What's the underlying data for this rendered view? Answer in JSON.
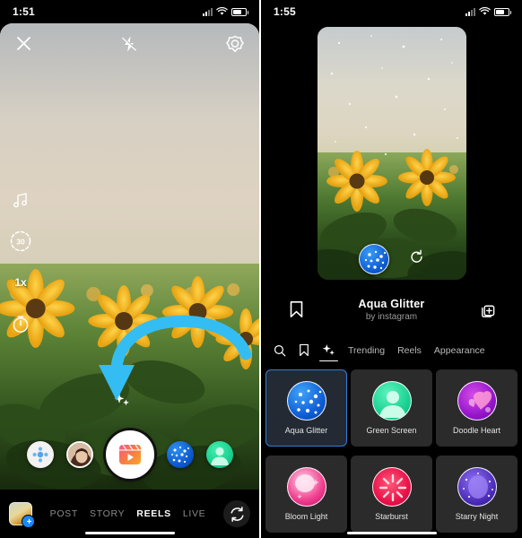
{
  "left_phone": {
    "status": {
      "time": "1:51",
      "signal_icon": "cellular-signal-icon",
      "wifi_icon": "wifi-icon",
      "battery_icon": "battery-icon"
    },
    "camera_top": {
      "close_label": "close-icon",
      "flash_label": "flash-off-icon",
      "settings_label": "settings-gear-icon"
    },
    "rail": [
      {
        "name": "music-icon",
        "label": ""
      },
      {
        "name": "duration-30s-icon",
        "label": "30"
      },
      {
        "name": "speed-icon",
        "label": "1x"
      },
      {
        "name": "timer-icon",
        "label": ""
      }
    ],
    "annotation": {
      "arrow": "curved-down-arrow",
      "color": "#33bdf2"
    },
    "effects_row": [
      {
        "name": "dial-effect",
        "label": "effects-dial"
      },
      {
        "name": "avatar-effect",
        "label": "user-avatar-effect"
      },
      {
        "name": "shutter",
        "label": "record-button"
      },
      {
        "name": "aqua-glitter-effect",
        "label": "Aqua Glitter"
      },
      {
        "name": "green-screen-effect",
        "label": "Green Screen"
      }
    ],
    "modes": [
      {
        "label": "POST",
        "active": false
      },
      {
        "label": "STORY",
        "active": false
      },
      {
        "label": "REELS",
        "active": true
      },
      {
        "label": "LIVE",
        "active": false
      }
    ],
    "gallery_thumb": {
      "name": "gallery-thumbnail",
      "badge": "+"
    },
    "flip_camera": "flip-camera-icon"
  },
  "right_phone": {
    "status": {
      "time": "1:55",
      "signal_icon": "cellular-signal-icon",
      "wifi_icon": "wifi-icon",
      "battery_icon": "battery-icon"
    },
    "preview": {
      "effect_button": "aqua-glitter-effect-button",
      "refresh_button": "reload-effect-icon"
    },
    "effect_meta": {
      "save_icon": "bookmark-icon",
      "title": "Aqua Glitter",
      "author": "by instagram",
      "collection_icon": "add-to-collection-icon"
    },
    "tabs": [
      {
        "label": "",
        "icon": "search-icon",
        "active": false
      },
      {
        "label": "",
        "icon": "bookmark-icon",
        "active": false
      },
      {
        "label": "",
        "icon": "sparkles-icon",
        "active": true
      },
      {
        "label": "Trending",
        "icon": "",
        "active": false
      },
      {
        "label": "Reels",
        "icon": "",
        "active": false
      },
      {
        "label": "Appearance",
        "icon": "",
        "active": false
      }
    ],
    "effects_grid": [
      {
        "name": "Aqua Glitter",
        "style": "b-aqua",
        "selected": true
      },
      {
        "name": "Green Screen",
        "style": "b-green",
        "selected": false
      },
      {
        "name": "Doodle Heart",
        "style": "b-doodle",
        "selected": false
      },
      {
        "name": "Bloom Light",
        "style": "b-bloom",
        "selected": false
      },
      {
        "name": "Starburst",
        "style": "b-star",
        "selected": false
      },
      {
        "name": "Starry Night",
        "style": "b-night",
        "selected": false
      }
    ]
  }
}
